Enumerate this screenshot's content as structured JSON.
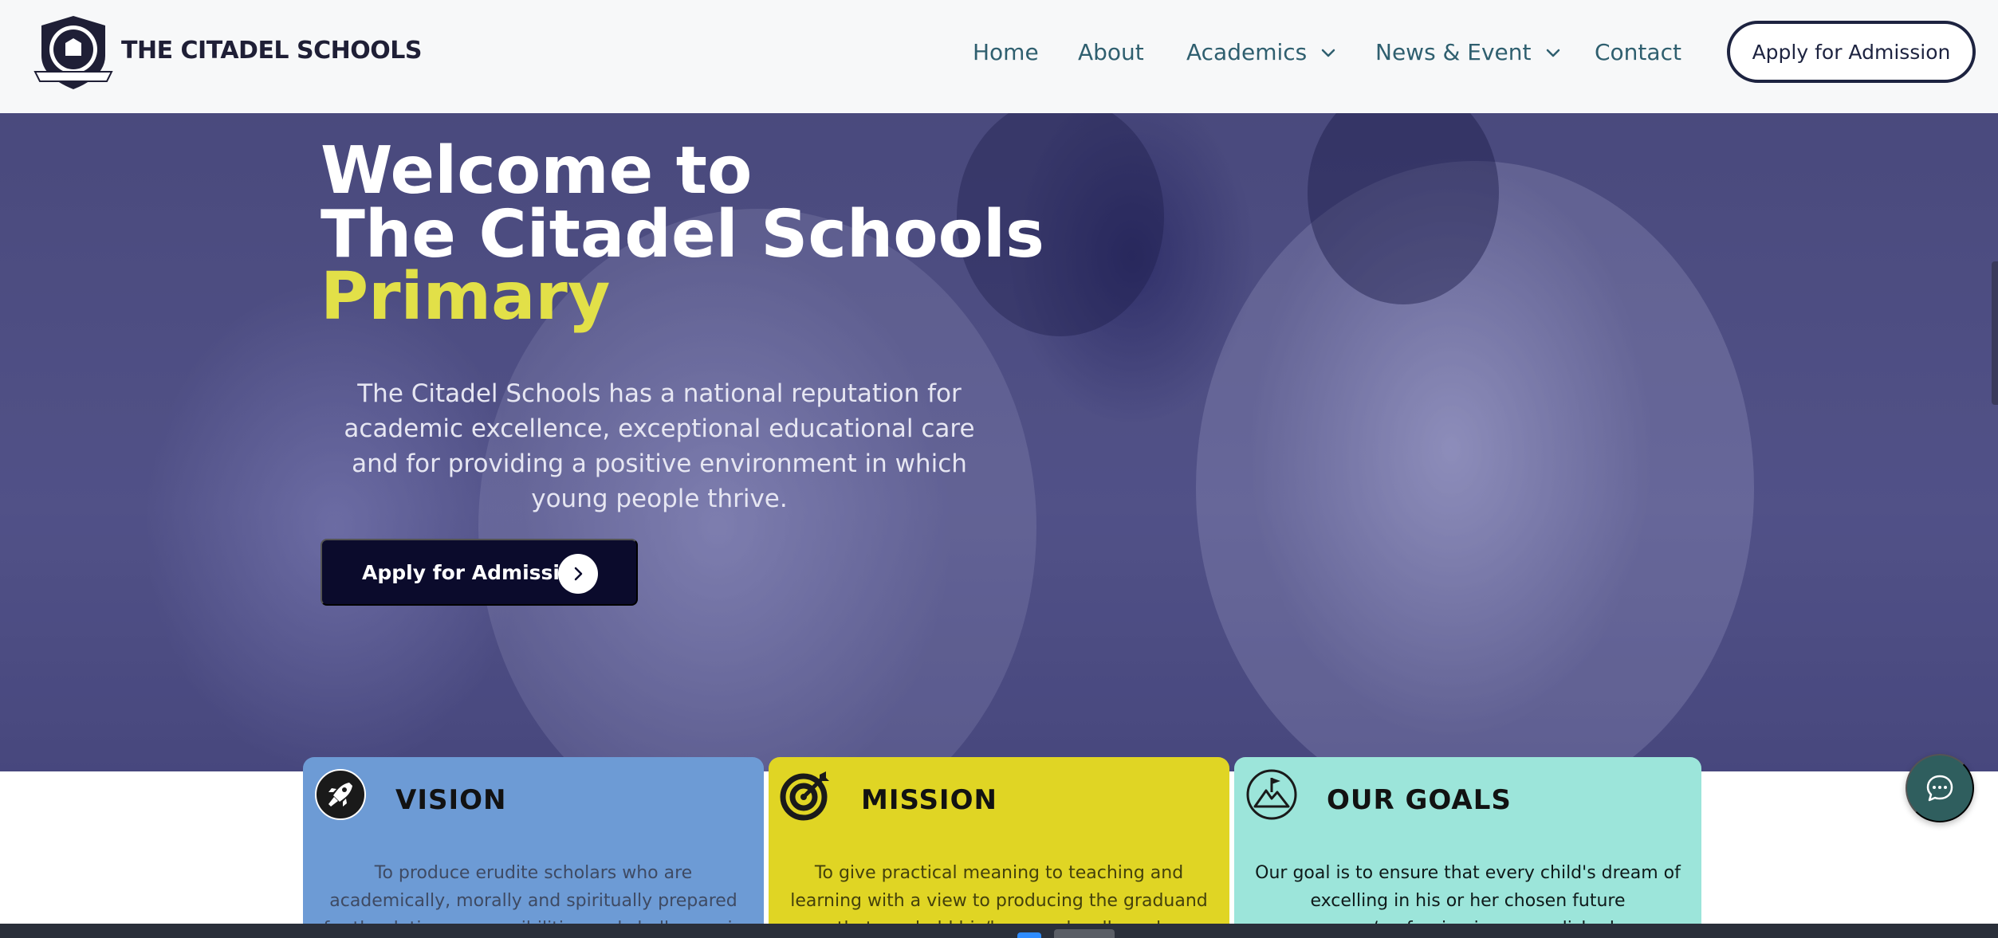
{
  "header": {
    "logo_text": "THE CITADEL SCHOOLS",
    "nav": {
      "home": "Home",
      "about": "About",
      "academics": "Academics",
      "news": "News & Event",
      "contact": "Contact"
    },
    "apply_button": "Apply for Admission"
  },
  "hero": {
    "line1": "Welcome to",
    "line2": "The Citadel Schools",
    "line3": "Primary",
    "description": "The Citadel Schools has a national reputation for academic excellence, exceptional educational care and for providing a positive environment in which young people thrive.",
    "cta_label": "Apply for Admission"
  },
  "cards": {
    "vision": {
      "title": "VISION",
      "text": "To produce erudite scholars who are academically, morally and spiritually prepared for the duties, responsibilities and challenges in life's endeavours."
    },
    "mission": {
      "title": "MISSION",
      "text": "To give practical meaning to teaching and learning with a view to producing the graduand that can hold his/her own locally and internationally."
    },
    "goals": {
      "title": "OUR GOALS",
      "text": "Our goal is to ensure that every child's dream of excelling in his or her chosen future career/profession is accomplished."
    }
  },
  "colors": {
    "nav_text": "#2f5f6f",
    "hero_accent": "#e2e048",
    "vision_bg": "#6d9bd5",
    "mission_bg": "#e0d524",
    "goals_bg": "#9ce5da",
    "chat_bg": "#2f5e5e"
  },
  "icons": {
    "logo": "shield-crest-icon",
    "vision": "rocket-icon",
    "mission": "target-icon",
    "goals": "mountain-flag-icon",
    "chat": "chat-bubble-icon",
    "cta": "chevron-right-icon"
  }
}
